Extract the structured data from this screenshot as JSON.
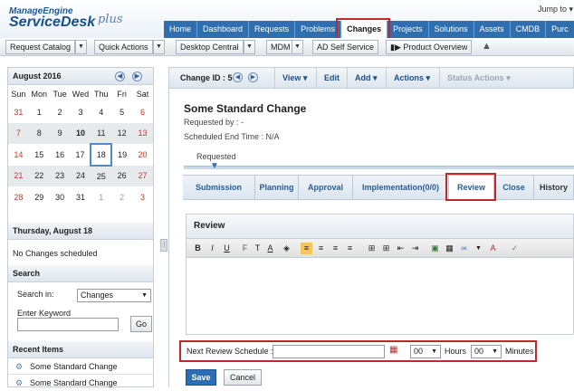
{
  "app": {
    "logo_top": "ManageEngine",
    "logo_main": "ServiceDesk",
    "logo_plus": "plus",
    "jump_to": "Jump to"
  },
  "nav_tabs": [
    "Home",
    "Dashboard",
    "Requests",
    "Problems",
    "Changes",
    "Projects",
    "Solutions",
    "Assets",
    "CMDB",
    "Purc"
  ],
  "active_tab": "Changes",
  "toolbar": {
    "request_catalog": "Request Catalog",
    "quick_actions": "Quick Actions",
    "desktop_central": "Desktop Central",
    "mdm": "MDM",
    "ad_self_service": "AD Self Service",
    "product_overview": "Product Overview"
  },
  "calendar": {
    "title": "August 2016",
    "days": [
      "Sun",
      "Mon",
      "Tue",
      "Wed",
      "Thu",
      "Fri",
      "Sat"
    ],
    "weeks": [
      [
        "31",
        "1",
        "2",
        "3",
        "4",
        "5",
        "6"
      ],
      [
        "7",
        "8",
        "9",
        "10",
        "11",
        "12",
        "13"
      ],
      [
        "14",
        "15",
        "16",
        "17",
        "18",
        "19",
        "20"
      ],
      [
        "21",
        "22",
        "23",
        "24",
        "25",
        "26",
        "27"
      ],
      [
        "28",
        "29",
        "30",
        "31",
        "1",
        "2",
        "3"
      ]
    ],
    "selected_day": "Thursday, August 18",
    "no_changes": "No Changes scheduled"
  },
  "search": {
    "title": "Search",
    "search_in_label": "Search in:",
    "search_in_value": "Changes",
    "keyword_label": "Enter Keyword",
    "go": "Go"
  },
  "recent": {
    "title": "Recent Items",
    "items": [
      "Some Standard Change",
      "Some Standard Change"
    ]
  },
  "change_bar": {
    "id": "Change ID : 5",
    "view": "View",
    "edit": "Edit",
    "add": "Add",
    "actions": "Actions",
    "status_actions": "Status Actions"
  },
  "change": {
    "title": "Some Standard Change",
    "requested_by": "Requested by : -",
    "scheduled_end": "Scheduled End Time : N/A",
    "stage": "Requested"
  },
  "stage_tabs": [
    "Submission",
    "Planning",
    "Approval",
    "Implementation(0/0)",
    "Review",
    "Close",
    "History"
  ],
  "active_stage_tab": "Review",
  "review": {
    "title": "Review",
    "next_label": "Next Review Schedule :",
    "hours_value": "00",
    "hours_label": "Hours",
    "minutes_value": "00",
    "minutes_label": "Minutes",
    "save": "Save",
    "cancel": "Cancel"
  },
  "colors": {
    "nav_blue": "#2f6fb0",
    "highlight_red": "#c0282c",
    "save_blue": "#2c6db3"
  }
}
